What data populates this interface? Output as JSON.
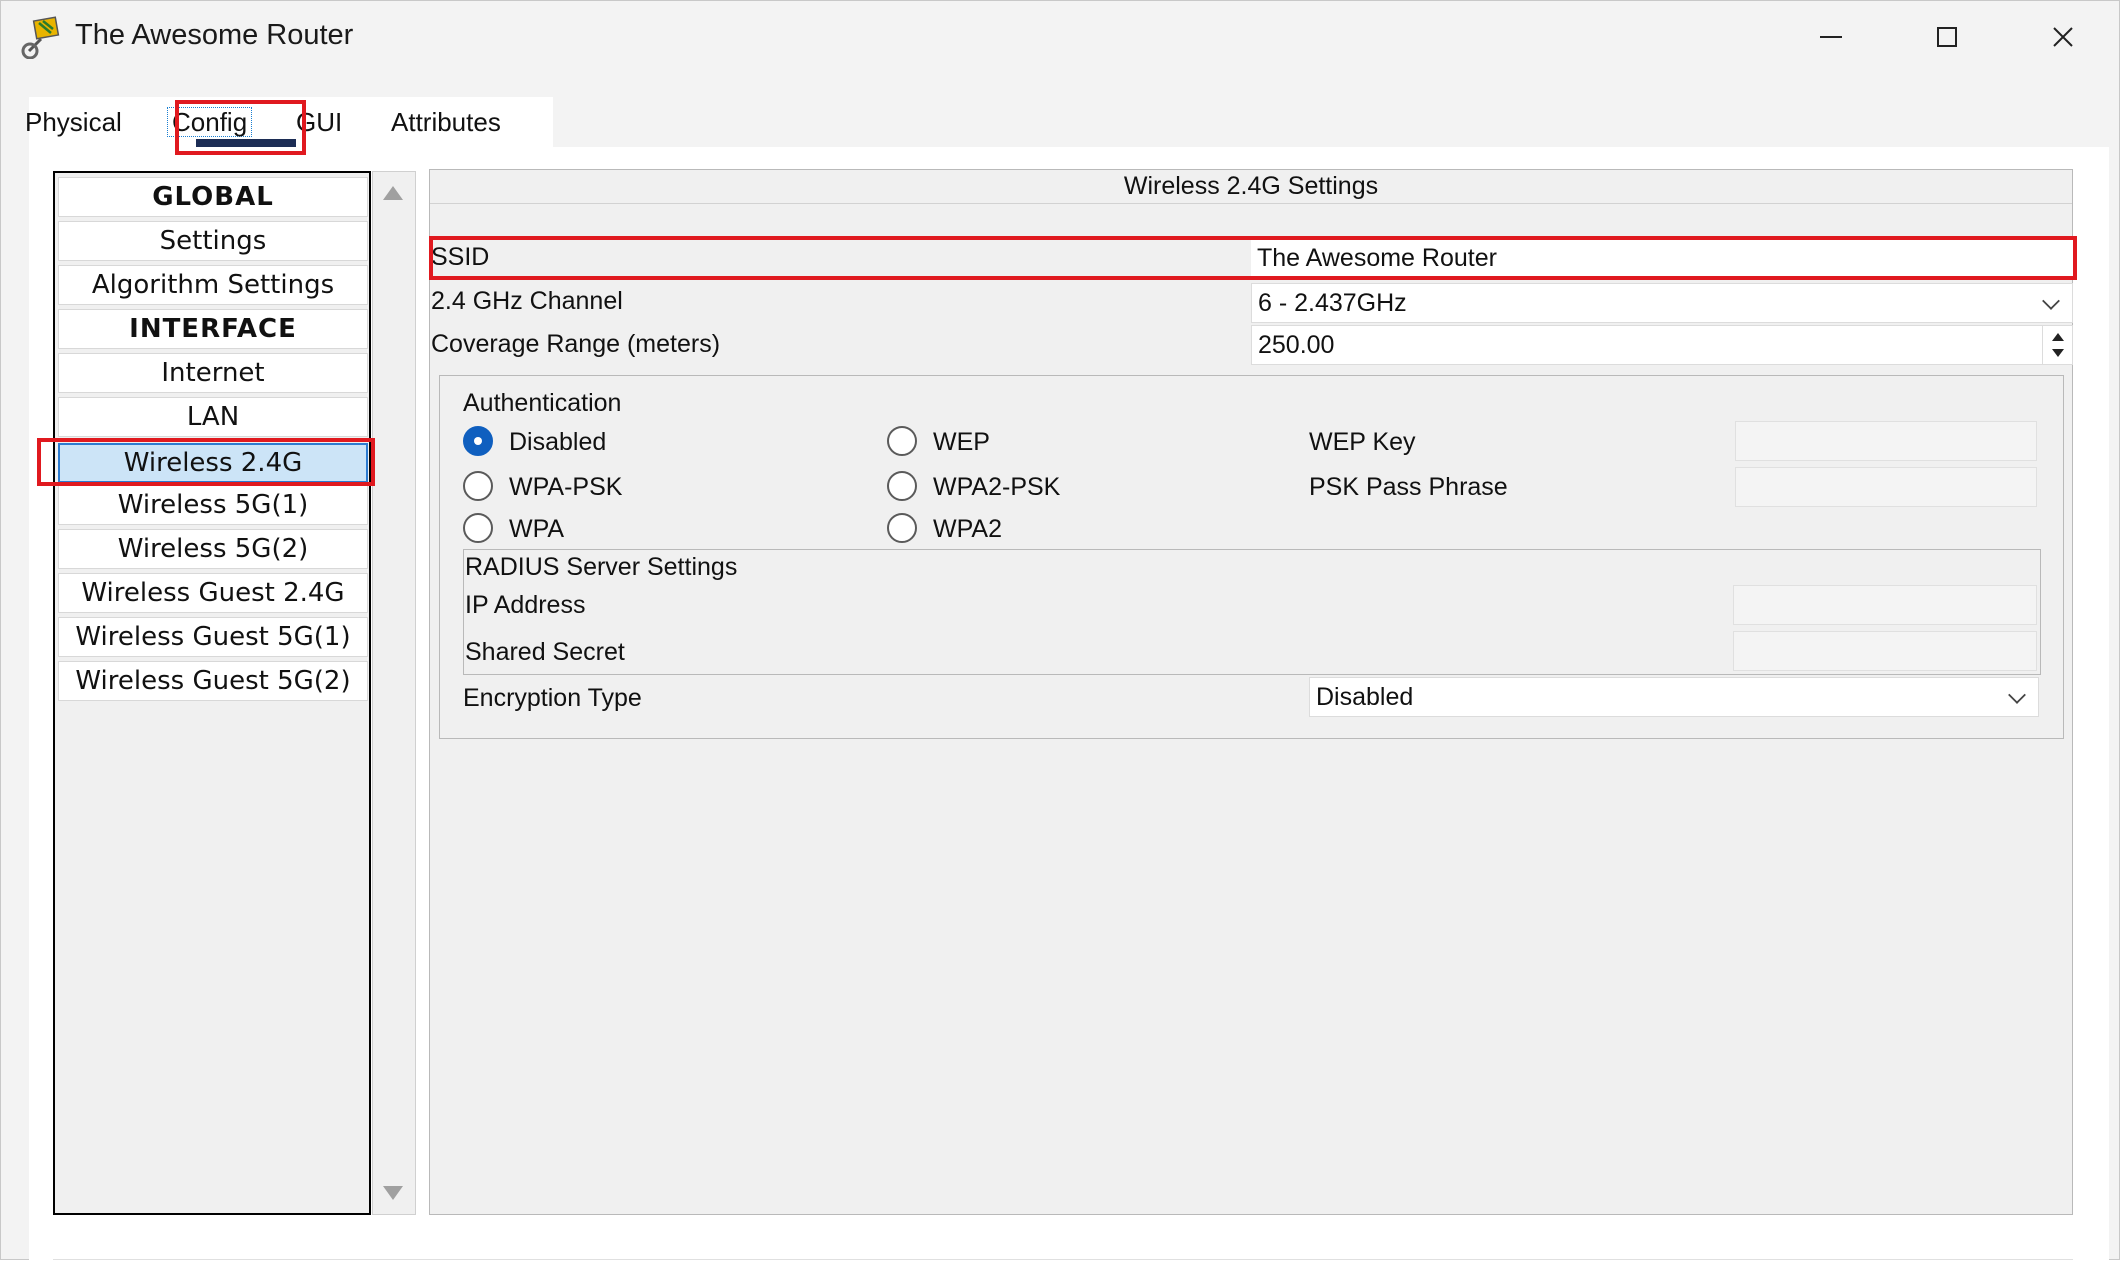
{
  "window": {
    "title": "The Awesome Router",
    "controls": {
      "minimize": "—",
      "maximize": "☐",
      "close": "✕"
    }
  },
  "tabs": [
    {
      "label": "Physical"
    },
    {
      "label": "Config"
    },
    {
      "label": "GUI"
    },
    {
      "label": "Attributes"
    }
  ],
  "sidebar": {
    "items": [
      {
        "label": "GLOBAL",
        "type": "header"
      },
      {
        "label": "Settings",
        "type": "item"
      },
      {
        "label": "Algorithm Settings",
        "type": "item"
      },
      {
        "label": "INTERFACE",
        "type": "header"
      },
      {
        "label": "Internet",
        "type": "item"
      },
      {
        "label": "LAN",
        "type": "item"
      },
      {
        "label": "Wireless 2.4G",
        "type": "item",
        "selected": true
      },
      {
        "label": "Wireless 5G(1)",
        "type": "item"
      },
      {
        "label": "Wireless 5G(2)",
        "type": "item"
      },
      {
        "label": "Wireless Guest 2.4G",
        "type": "item"
      },
      {
        "label": "Wireless Guest 5G(1)",
        "type": "item"
      },
      {
        "label": "Wireless Guest 5G(2)",
        "type": "item"
      }
    ]
  },
  "panel": {
    "title": "Wireless 2.4G Settings",
    "ssid": {
      "label": "SSID",
      "value": "The Awesome Router"
    },
    "channel": {
      "label": "2.4 GHz Channel",
      "value": "6 - 2.437GHz"
    },
    "coverage": {
      "label": "Coverage Range (meters)",
      "value": "250.00"
    },
    "authentication": {
      "label": "Authentication",
      "options": [
        {
          "label": "Disabled",
          "checked": true
        },
        {
          "label": "WEP",
          "checked": false
        },
        {
          "label": "WPA-PSK",
          "checked": false
        },
        {
          "label": "WPA2-PSK",
          "checked": false
        },
        {
          "label": "WPA",
          "checked": false
        },
        {
          "label": "WPA2",
          "checked": false
        }
      ],
      "wep_key_label": "WEP Key",
      "psk_label": "PSK Pass Phrase"
    },
    "radius": {
      "title": "RADIUS Server Settings",
      "ip_label": "IP Address",
      "secret_label": "Shared Secret"
    },
    "encryption": {
      "label": "Encryption Type",
      "value": "Disabled"
    }
  },
  "colors": {
    "highlight": "#e0191f",
    "selection": "#cce4f7",
    "accent": "#0f5fbf"
  }
}
